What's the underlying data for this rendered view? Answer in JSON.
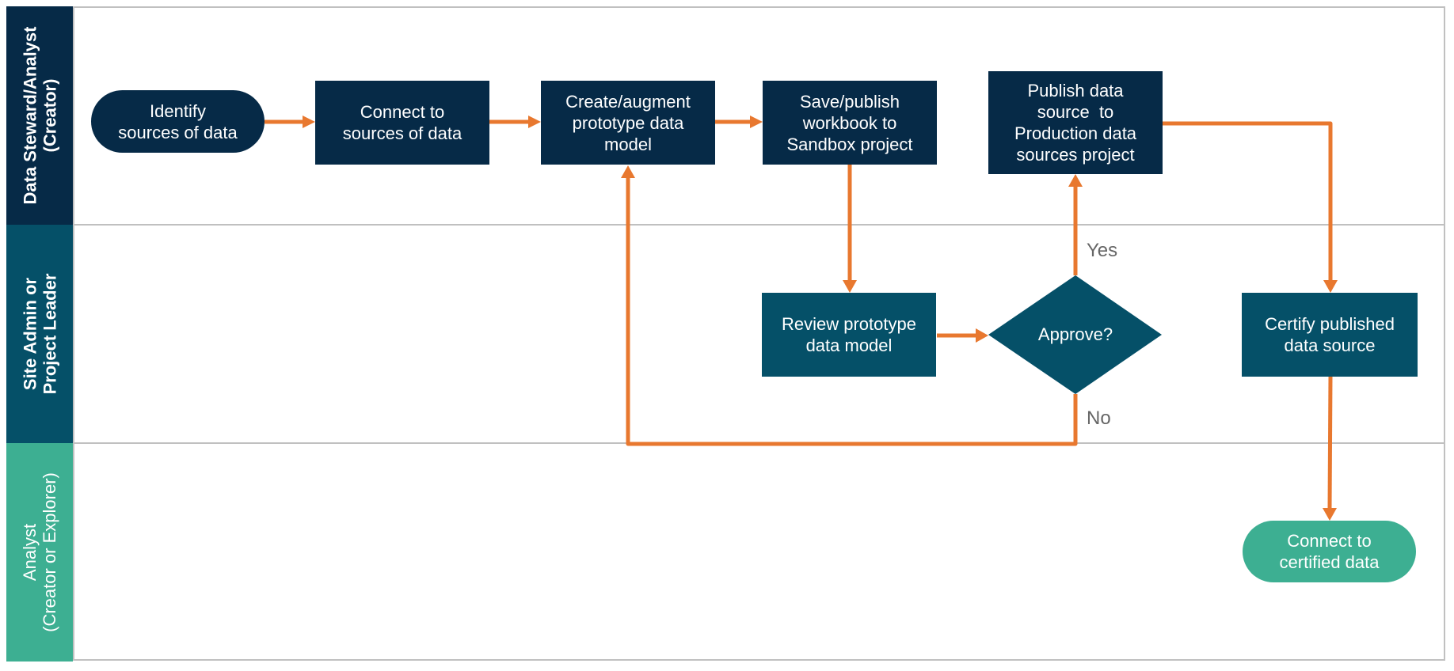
{
  "lanes": [
    {
      "label_line1": "Data Steward/Analyst",
      "label_line2": "(Creator)",
      "color": "#062a47"
    },
    {
      "label_line1": "Site Admin or",
      "label_line2": "Project Leader",
      "color": "#055068"
    },
    {
      "label_line1": "Analyst",
      "label_line2": "(Creator or Explorer)",
      "color": "#3daf92"
    }
  ],
  "nodes": {
    "identify": {
      "line1": "Identify",
      "line2": "sources of data",
      "shape": "terminal",
      "lane": 1
    },
    "connect": {
      "line1": "Connect to",
      "line2": "sources of data",
      "shape": "process",
      "lane": 1
    },
    "create": {
      "line1": "Create/augment",
      "line2": "prototype data",
      "line3": "model",
      "shape": "process",
      "lane": 1
    },
    "save": {
      "line1": "Save/publish",
      "line2": "workbook to",
      "line3": "Sandbox project",
      "shape": "process",
      "lane": 1
    },
    "publish": {
      "line1": "Publish data",
      "line2": "source  to",
      "line3": "Production data",
      "line4": "sources project",
      "shape": "process",
      "lane": 1
    },
    "review": {
      "line1": "Review prototype",
      "line2": "data model",
      "shape": "process",
      "lane": 2
    },
    "approve": {
      "label": "Approve?",
      "shape": "decision",
      "lane": 2
    },
    "certify": {
      "line1": "Certify published",
      "line2": "data source",
      "shape": "process",
      "lane": 2
    },
    "certified": {
      "line1": "Connect to",
      "line2": "certified data",
      "shape": "terminal",
      "lane": 3
    }
  },
  "edges": [
    {
      "from": "identify",
      "to": "connect"
    },
    {
      "from": "connect",
      "to": "create"
    },
    {
      "from": "create",
      "to": "save"
    },
    {
      "from": "save",
      "to": "review"
    },
    {
      "from": "review",
      "to": "approve"
    },
    {
      "from": "approve",
      "to": "publish",
      "label": "Yes"
    },
    {
      "from": "approve",
      "to": "create",
      "label": "No"
    },
    {
      "from": "publish",
      "to": "certify"
    },
    {
      "from": "certify",
      "to": "certified"
    }
  ],
  "branch_labels": {
    "yes": "Yes",
    "no": "No"
  },
  "colors": {
    "navy": "#062a47",
    "teal": "#055068",
    "green": "#3daf92",
    "arrow": "#e8782f",
    "grid": "#c0c0c0"
  }
}
